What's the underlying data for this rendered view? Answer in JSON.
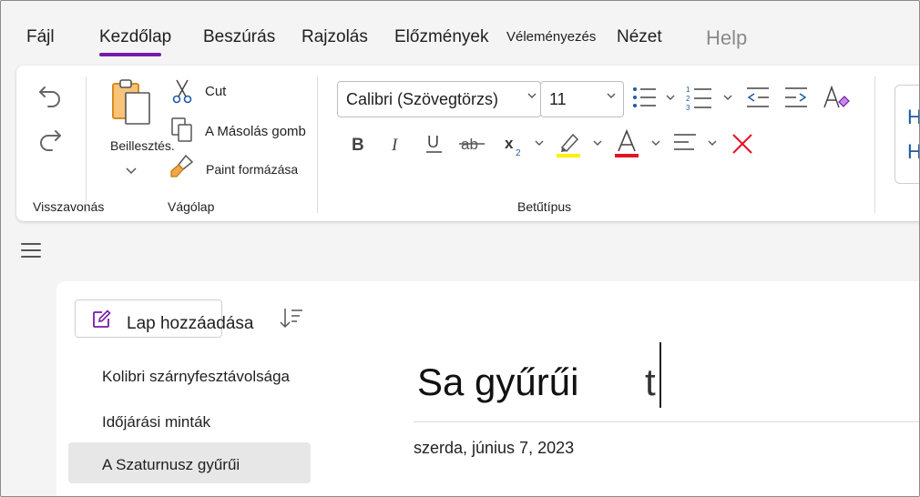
{
  "tabs": [
    {
      "label": "Fájl"
    },
    {
      "label": "Kezdőlap"
    },
    {
      "label": "Beszúrás"
    },
    {
      "label": "Rajzolás"
    },
    {
      "label": "Előzmények"
    },
    {
      "label": "Véleményezés"
    },
    {
      "label": "Nézet"
    },
    {
      "label": "Help"
    }
  ],
  "ribbon": {
    "undo_group_label": "Visszavonás",
    "clipboard": {
      "paste_label": "Beillesztés.",
      "cut_label": "Cut",
      "copy_label": "A Másolás gomb",
      "format_painter_label": "Paint formázása",
      "group_label": "Vágólap"
    },
    "font": {
      "font_name": "Calibri (Szövegtörzs)",
      "font_size": "11",
      "group_label": "Betűtípus",
      "highlight_color": "#ffef00",
      "font_color": "#e81123"
    },
    "styles_partial": [
      "H",
      "H"
    ]
  },
  "pages_panel": {
    "add_page_label": "Lap hozzáadása",
    "items": [
      {
        "label": "Kolibri szárnyfesztávolsága"
      },
      {
        "label": "Időjárási minták"
      },
      {
        "label": "A Szaturnusz gyűrűi"
      }
    ]
  },
  "page": {
    "title": "Sa gyűrűi",
    "title_tail": "t",
    "date": "szerda, június 7, 2023"
  },
  "colors": {
    "accent": "#7719aa",
    "list_blue": "#1f5aa6"
  }
}
